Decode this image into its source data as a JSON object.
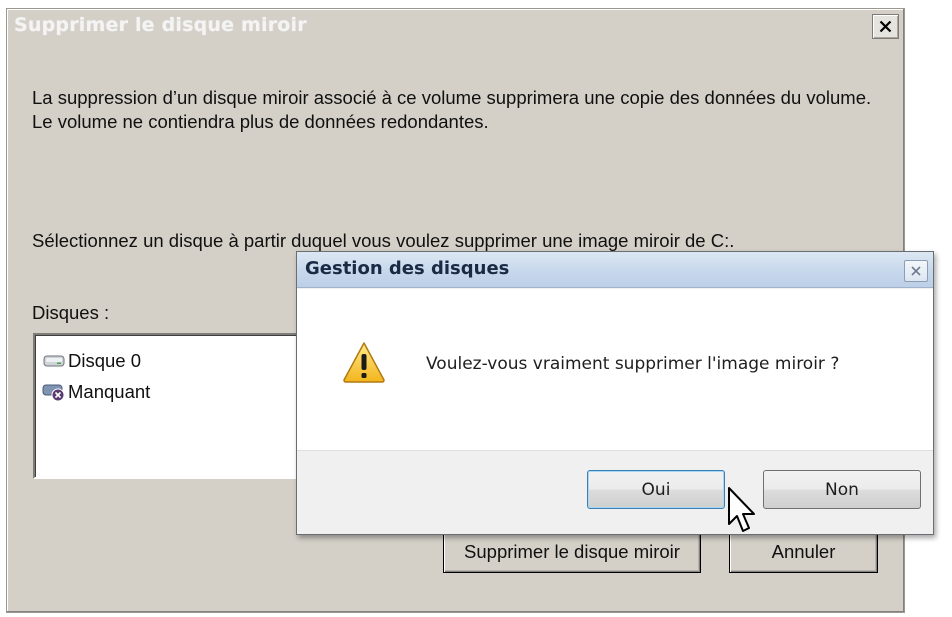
{
  "main_dialog": {
    "title": "Supprimer le disque miroir",
    "description": "La suppression d’un disque miroir associé à ce volume supprimera une copie des données du volume. Le volume ne contiendra plus de données redondantes.",
    "select_prompt": "Sélectionnez un disque à partir duquel vous voulez supprimer une image miroir de C:.",
    "disks_label": "Disques :",
    "disks": [
      {
        "label": "Disque 0",
        "icon": "disk-drive-icon"
      },
      {
        "label": "Manquant",
        "icon": "missing-disk-icon"
      }
    ],
    "remove_button": "Supprimer le disque miroir",
    "cancel_button": "Annuler"
  },
  "confirm_dialog": {
    "title": "Gestion des disques",
    "message": "Voulez-vous vraiment supprimer l'image miroir ?",
    "icon": "warning-icon",
    "yes_button": "Oui",
    "no_button": "Non"
  },
  "colors": {
    "dialog_face": "#d4d0c8",
    "modal_titlebar": "#c7d8ec",
    "modal_body": "#ffffff",
    "default_button_border": "#3c7fb1"
  }
}
